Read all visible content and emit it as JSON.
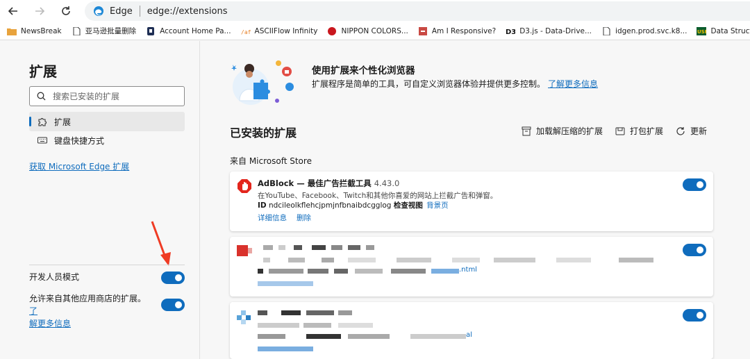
{
  "browser": {
    "app_name": "Edge",
    "url": "edge://extensions"
  },
  "bookmarks": [
    {
      "label": "NewsBreak",
      "icon": "folder-icon"
    },
    {
      "label": "亚马逊批量删除",
      "icon": "page-icon"
    },
    {
      "label": "Account Home Pa...",
      "icon": "bookmark-icon"
    },
    {
      "label": "ASCIIFlow Infinity",
      "icon": "asciiflow-icon"
    },
    {
      "label": "NIPPON COLORS...",
      "icon": "nippon-icon"
    },
    {
      "label": "Am I Responsive?",
      "icon": "responsive-icon"
    },
    {
      "label": "D3.js - Data-Drive...",
      "icon": "d3-icon"
    },
    {
      "label": "idgen.prod.svc.k8...",
      "icon": "page-icon"
    },
    {
      "label": "Data Structure Vis...",
      "icon": "usf-icon"
    }
  ],
  "sidebar": {
    "title": "扩展",
    "search_placeholder": "搜索已安装的扩展",
    "items": [
      {
        "label": "扩展",
        "active": true
      },
      {
        "label": "键盘快捷方式",
        "active": false
      }
    ],
    "get_extensions_link": "获取 Microsoft Edge 扩展",
    "dev_mode_label": "开发人员模式",
    "dev_mode_on": true,
    "allow_other_stores_label": "允许来自其他应用商店的扩展。",
    "allow_other_stores_link_part1": "了",
    "allow_other_stores_link_part2": "解更多信息",
    "allow_other_stores_on": true
  },
  "main": {
    "hero_title": "使用扩展来个性化浏览器",
    "hero_desc": "扩展程序是简单的工具，可自定义浏览器体验并提供更多控制。",
    "hero_link": "了解更多信息",
    "installed_title": "已安装的扩展",
    "actions": {
      "load_unpacked": "加载解压缩的扩展",
      "pack": "打包扩展",
      "update": "更新"
    },
    "from_store": "来自 Microsoft Store",
    "extensions": [
      {
        "name": "AdBlock — 最佳广告拦截工具",
        "version": "4.43.0",
        "description": "在YouTube、Facebook、Twitch和其他你喜爱的网站上拦截广告和弹窗。",
        "id_label": "ID",
        "id": "ndcileolkflehcjpmjnfbnaibdcgglog",
        "inspect_label": "检查视图",
        "background_link": "背景页",
        "details_link": "详细信息",
        "remove_link": "删除",
        "enabled": true
      },
      {
        "blurred": true,
        "visible_fragment": ".ntml",
        "enabled": true
      },
      {
        "blurred": true,
        "visible_fragment": "al",
        "enabled": true
      }
    ]
  },
  "colors": {
    "accent": "#0f6cbd",
    "annotation_arrow": "#ef3b24"
  }
}
